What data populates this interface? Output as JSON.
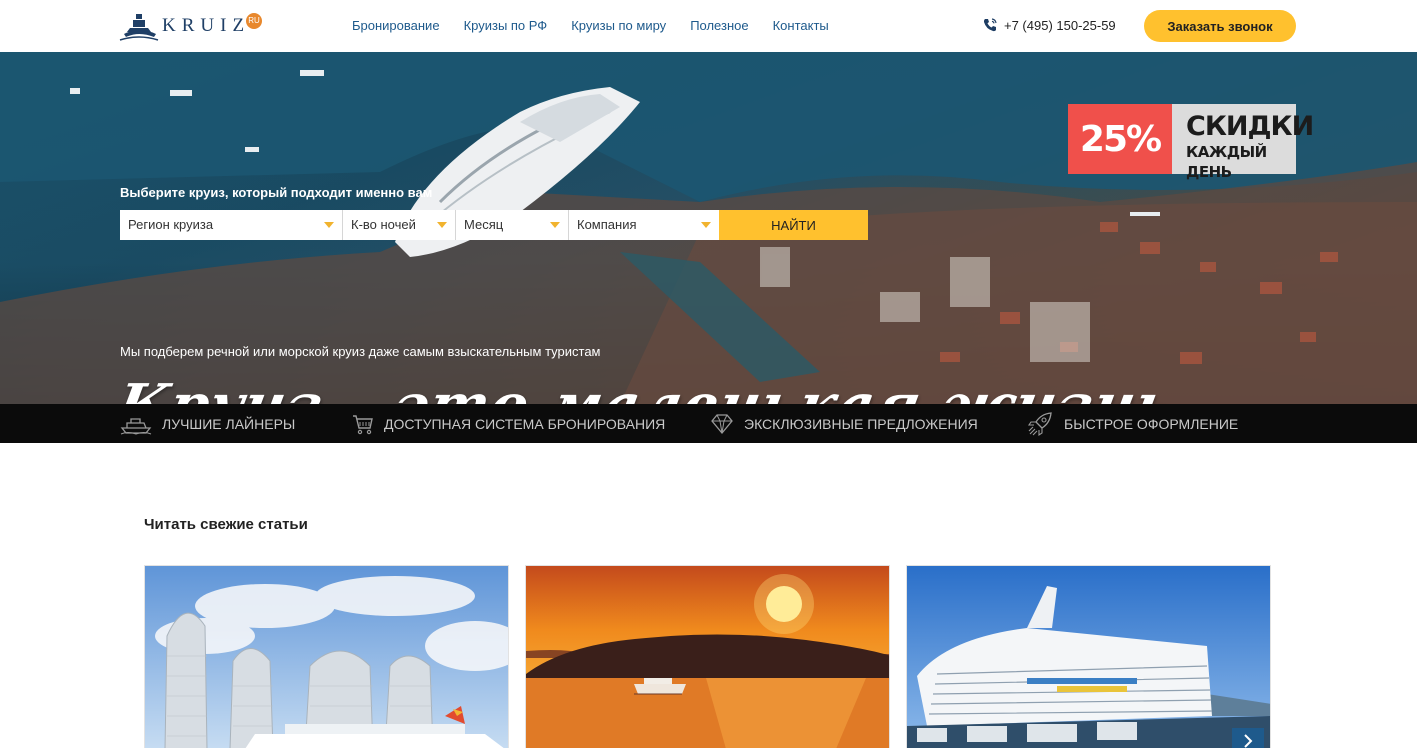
{
  "header": {
    "logo_text": "KRUIZ",
    "logo_badge": "RU",
    "nav": [
      "Бронирование",
      "Круизы по РФ",
      "Круизы по миру",
      "Полезное",
      "Контакты"
    ],
    "phone": "+7 (495) 150-25-59",
    "call_button": "Заказать звонок"
  },
  "promo": {
    "percent": "25%",
    "line1": "СКИДКИ",
    "line2": "КАЖДЫЙ ДЕНЬ"
  },
  "search": {
    "label": "Выберите круиз, который подходит именно вам",
    "region": "Регион круиза",
    "nights": "К-во ночей",
    "month": "Месяц",
    "company": "Компания",
    "submit": "НАЙТИ"
  },
  "hero": {
    "tagline": "Мы подберем речной или морской круиз даже самым взыскательным туристам",
    "slogan": "Круиз – это маленькая жизнь"
  },
  "features": [
    {
      "icon": "ship-icon",
      "label": "ЛУЧШИЕ ЛАЙНЕРЫ"
    },
    {
      "icon": "cart-icon",
      "label": "ДОСТУПНАЯ СИСТЕМА БРОНИРОВАНИЯ"
    },
    {
      "icon": "diamond-icon",
      "label": "ЭКСКЛЮЗИВНЫЕ ПРЕДЛОЖЕНИЯ"
    },
    {
      "icon": "rocket-icon",
      "label": "БЫСТРОЕ ОФОРМЛЕНИЕ"
    }
  ],
  "articles": {
    "title": "Читать свежие статьи",
    "cards": [
      {
        "image": "towers-harbor-photo"
      },
      {
        "image": "sunset-cruise-photo"
      },
      {
        "image": "cruise-liner-photo"
      }
    ]
  },
  "colors": {
    "accent_yellow": "#ffc12e",
    "nav_blue": "#1e5a8c",
    "promo_red": "#f0504b",
    "features_bg": "#0b0b0b"
  }
}
